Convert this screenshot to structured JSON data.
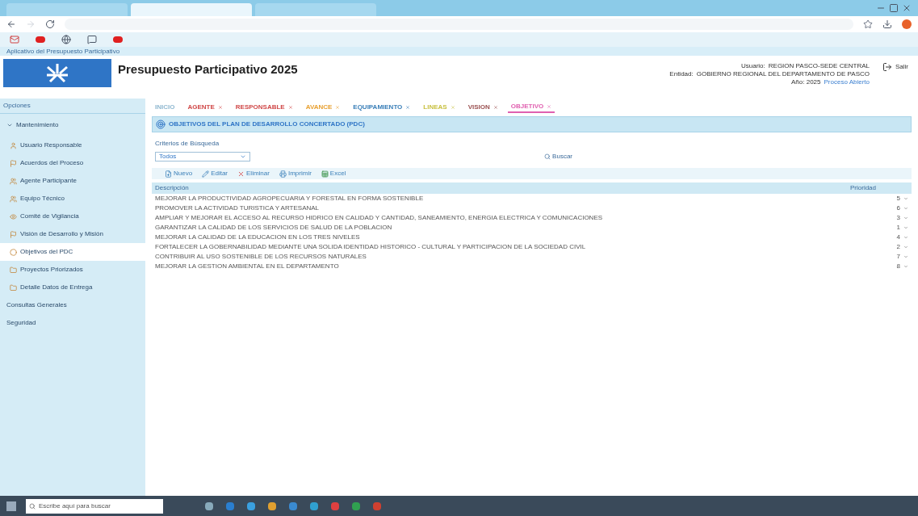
{
  "browser": {
    "tabs": [
      {
        "selected": false
      },
      {
        "selected": true
      },
      {
        "selected": false
      }
    ]
  },
  "page": {
    "banner": "Aplicativo del Presupuesto Participativo",
    "title": "Presupuesto Participativo 2025"
  },
  "session": {
    "lines": [
      {
        "label": "Usuario:",
        "value": "REGION PASCO-SEDE CENTRAL"
      },
      {
        "label": "Entidad:",
        "value": "GOBIERNO REGIONAL DEL DEPARTAMENTO DE PASCO"
      }
    ],
    "year": "Año: 2025",
    "status": "Proceso Abierto",
    "logout": "Salir"
  },
  "sidebar": {
    "title": "Opciones",
    "group": {
      "label": "Mantenimiento",
      "expanded": true,
      "children": [
        {
          "label": "Usuario Responsable",
          "selected": false
        },
        {
          "label": "Acuerdos del Proceso",
          "selected": false
        },
        {
          "label": "Agente Participante",
          "selected": false
        },
        {
          "label": "Equipo Técnico",
          "selected": false
        },
        {
          "label": "Comité de Vigilancia",
          "selected": false
        },
        {
          "label": "Visión de Desarrollo y Misión",
          "selected": false
        },
        {
          "label": "Objetivos del PDC",
          "selected": true
        },
        {
          "label": "Proyectos Priorizados",
          "selected": false
        },
        {
          "label": "Detalle Datos de Entrega",
          "selected": false
        }
      ]
    },
    "items": [
      "Consultas Generales",
      "Seguridad"
    ]
  },
  "tabs": [
    {
      "label": "INICIO",
      "color": "#8fb8d0",
      "selected": false,
      "closable": false
    },
    {
      "label": "AGENTE",
      "color": "#d04848",
      "selected": false,
      "closable": true
    },
    {
      "label": "RESPONSABLE",
      "color": "#d04848",
      "selected": false,
      "closable": true
    },
    {
      "label": "AVANCE",
      "color": "#e8a030",
      "selected": false,
      "closable": true
    },
    {
      "label": "EQUIPAMIENTO",
      "color": "#3a7fb8",
      "selected": false,
      "closable": true
    },
    {
      "label": "LINEAS",
      "color": "#c8c040",
      "selected": false,
      "closable": true
    },
    {
      "label": "VISION",
      "color": "#9a5050",
      "selected": false,
      "closable": true
    },
    {
      "label": "OBJETIVO",
      "color": "#e060b0",
      "selected": true,
      "closable": true
    }
  ],
  "panel": {
    "title": "OBJETIVOS DEL PLAN DE DESARROLLO CONCERTADO (PDC)",
    "criteria": "Criterios de Búsqueda",
    "filter": {
      "value": "Todos"
    },
    "search_button": "Buscar",
    "toolbar": [
      {
        "kind": "new",
        "label": "Nuevo"
      },
      {
        "kind": "edit",
        "label": "Editar"
      },
      {
        "kind": "delete",
        "label": "Eliminar"
      },
      {
        "kind": "print",
        "label": "Imprimir"
      },
      {
        "kind": "excel",
        "label": "Excel"
      }
    ]
  },
  "table": {
    "columns": [
      "Descripción",
      "Prioridad"
    ],
    "rows": [
      {
        "description": "MEJORAR LA PRODUCTIVIDAD AGROPECUARIA Y FORESTAL EN FORMA SOSTENIBLE",
        "priority": "5"
      },
      {
        "description": "PROMOVER LA ACTIVIDAD TURISTICA Y ARTESANAL",
        "priority": "6"
      },
      {
        "description": "AMPLIAR Y MEJORAR EL ACCESO AL RECURSO HIDRICO EN CALIDAD Y CANTIDAD, SANEAMIENTO, ENERGIA ELECTRICA Y COMUNICACIONES",
        "priority": "3"
      },
      {
        "description": "GARANTIZAR LA CALIDAD DE LOS SERVICIOS DE SALUD DE LA POBLACION",
        "priority": "1"
      },
      {
        "description": "MEJORAR LA CALIDAD DE LA EDUCACION EN LOS TRES NIVELES",
        "priority": "4"
      },
      {
        "description": "FORTALECER LA GOBERNABILIDAD MEDIANTE UNA SOLIDA IDENTIDAD HISTORICO - CULTURAL Y PARTICIPACION DE LA SOCIEDAD CIVIL",
        "priority": "2"
      },
      {
        "description": "CONTRIBUIR AL USO SOSTENIBLE DE LOS RECURSOS NATURALES",
        "priority": "7"
      },
      {
        "description": "MEJORAR LA GESTION AMBIENTAL EN EL DEPARTAMENTO",
        "priority": "8"
      }
    ]
  },
  "taskbar": {
    "search_placeholder": "Escribe aquí para buscar"
  }
}
